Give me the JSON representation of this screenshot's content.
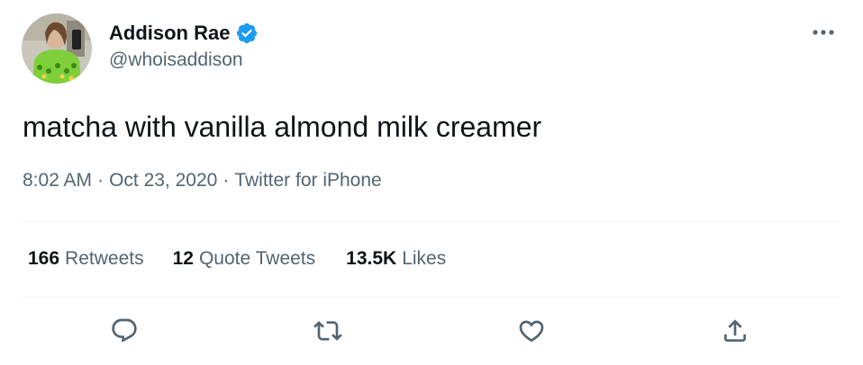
{
  "user": {
    "display_name": "Addison Rae",
    "handle": "@whoisaddison",
    "verified": true,
    "avatar_icon": "user-avatar"
  },
  "tweet": {
    "text": "matcha with vanilla almond milk creamer",
    "time": "8:02 AM",
    "date": "Oct 23, 2020",
    "separator": "·",
    "source": "Twitter for iPhone"
  },
  "stats": {
    "retweets_count": "166",
    "retweets_label": "Retweets",
    "quotes_count": "12",
    "quotes_label": "Quote Tweets",
    "likes_count": "13.5K",
    "likes_label": "Likes"
  },
  "actions": [
    {
      "icon": "reply-icon"
    },
    {
      "icon": "retweet-icon"
    },
    {
      "icon": "like-icon"
    },
    {
      "icon": "share-icon"
    }
  ],
  "colors": {
    "text_primary": "#0f1419",
    "text_secondary": "#536471",
    "verified_blue": "#1d9bf0",
    "divider": "#eff3f4"
  }
}
